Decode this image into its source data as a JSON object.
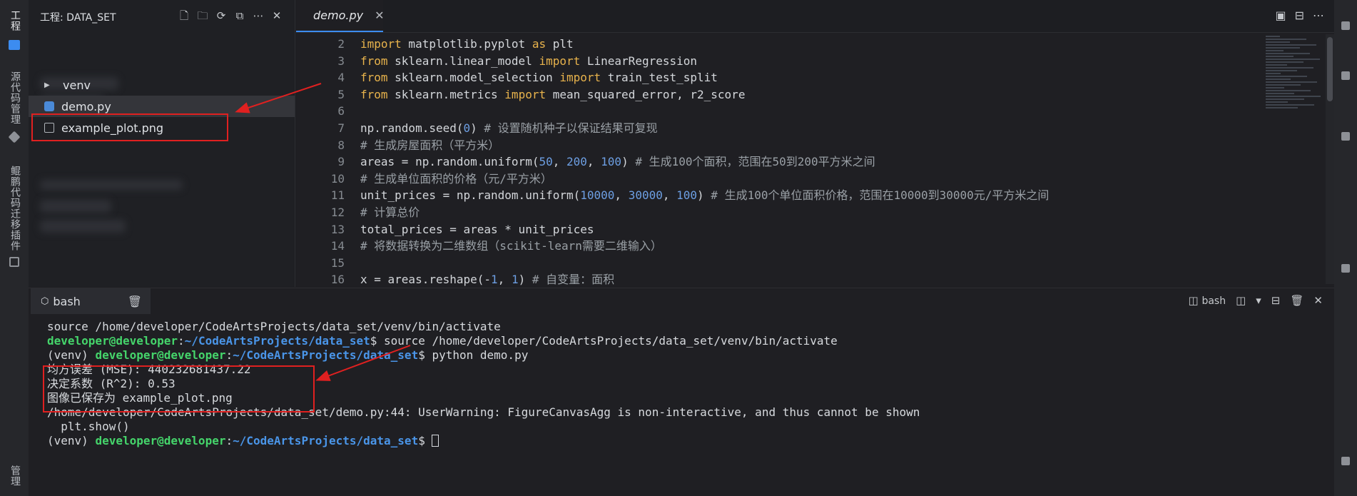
{
  "activity_bar": {
    "items": [
      {
        "label": "工程"
      },
      {
        "label": "源代码管理"
      },
      {
        "label": "鲲鹏代码迁移插件"
      },
      {
        "label": "管理"
      }
    ]
  },
  "explorer": {
    "title": "工程: DATA_SET",
    "actions": [
      "new-file-icon",
      "new-folder-icon",
      "refresh-icon",
      "collapse-icon",
      "more-icon",
      "close-icon"
    ],
    "items": [
      {
        "label": "venv",
        "type": "folder"
      },
      {
        "label": "demo.py",
        "type": "python"
      },
      {
        "label": "example_plot.png",
        "type": "image"
      }
    ]
  },
  "editor": {
    "tab_label": "demo.py",
    "lines": [
      {
        "n": "2",
        "parts": [
          [
            "kw",
            "import"
          ],
          [
            "t",
            " matplotlib.pyplot "
          ],
          [
            "kw",
            "as"
          ],
          [
            "t",
            " plt"
          ]
        ]
      },
      {
        "n": "3",
        "parts": [
          [
            "kw",
            "from"
          ],
          [
            "t",
            " sklearn.linear_model "
          ],
          [
            "kw",
            "import"
          ],
          [
            "t",
            " LinearRegression"
          ]
        ]
      },
      {
        "n": "4",
        "parts": [
          [
            "kw",
            "from"
          ],
          [
            "t",
            " sklearn.model_selection "
          ],
          [
            "kw",
            "import"
          ],
          [
            "t",
            " train_test_split"
          ]
        ]
      },
      {
        "n": "5",
        "parts": [
          [
            "kw",
            "from"
          ],
          [
            "t",
            " sklearn.metrics "
          ],
          [
            "kw",
            "import"
          ],
          [
            "t",
            " mean_squared_error, r2_score"
          ]
        ]
      },
      {
        "n": "6",
        "parts": []
      },
      {
        "n": "7",
        "parts": [
          [
            "t",
            "np.random.seed("
          ],
          [
            "num",
            "0"
          ],
          [
            "t",
            ") "
          ],
          [
            "cm",
            "# 设置随机种子以保证结果可复现"
          ]
        ]
      },
      {
        "n": "8",
        "parts": [
          [
            "cm",
            "# 生成房屋面积（平方米）"
          ]
        ]
      },
      {
        "n": "9",
        "parts": [
          [
            "t",
            "areas = np.random.uniform("
          ],
          [
            "num",
            "50"
          ],
          [
            "t",
            ", "
          ],
          [
            "num",
            "200"
          ],
          [
            "t",
            ", "
          ],
          [
            "num",
            "100"
          ],
          [
            "t",
            ") "
          ],
          [
            "cm",
            "# 生成100个面积，范围在50到200平方米之间"
          ]
        ]
      },
      {
        "n": "10",
        "parts": [
          [
            "cm",
            "# 生成单位面积的价格（元/平方米）"
          ]
        ]
      },
      {
        "n": "11",
        "parts": [
          [
            "t",
            "unit_prices = np.random.uniform("
          ],
          [
            "num",
            "10000"
          ],
          [
            "t",
            ", "
          ],
          [
            "num",
            "30000"
          ],
          [
            "t",
            ", "
          ],
          [
            "num",
            "100"
          ],
          [
            "t",
            ") "
          ],
          [
            "cm",
            "# 生成100个单位面积价格，范围在10000到30000元/平方米之间"
          ]
        ]
      },
      {
        "n": "12",
        "parts": [
          [
            "cm",
            "# 计算总价"
          ]
        ]
      },
      {
        "n": "13",
        "parts": [
          [
            "t",
            "total_prices = areas * unit_prices"
          ]
        ]
      },
      {
        "n": "14",
        "parts": [
          [
            "cm",
            "# 将数据转换为二维数组（scikit-learn需要二维输入）"
          ]
        ]
      },
      {
        "n": "15",
        "parts": []
      },
      {
        "n": "16",
        "parts": [
          [
            "t",
            "x = areas.reshape(-"
          ],
          [
            "num",
            "1"
          ],
          [
            "t",
            ", "
          ],
          [
            "num",
            "1"
          ],
          [
            "t",
            ") "
          ],
          [
            "cm",
            "# 自变量：面积"
          ]
        ]
      }
    ]
  },
  "terminal": {
    "tab_label": "bash",
    "shell_label": "bash",
    "lines": [
      [
        [
          "t",
          "source /home/developer/CodeArtsProjects/data_set/venv/bin/activate"
        ]
      ],
      [
        [
          "green",
          "developer@developer"
        ],
        [
          "t",
          ":"
        ],
        [
          "blue",
          "~/CodeArtsProjects/data_set"
        ],
        [
          "t",
          "$ source /home/developer/CodeArtsProjects/data_set/venv/bin/activate"
        ]
      ],
      [
        [
          "t",
          "(venv) "
        ],
        [
          "green",
          "developer@developer"
        ],
        [
          "t",
          ":"
        ],
        [
          "blue",
          "~/CodeArtsProjects/data_set"
        ],
        [
          "t",
          "$ python demo.py"
        ]
      ],
      [
        [
          "t",
          "均方误差 (MSE): 440232681437.22"
        ]
      ],
      [
        [
          "t",
          "决定系数 (R^2): 0.53"
        ]
      ],
      [
        [
          "t",
          "图像已保存为 example_plot.png"
        ]
      ],
      [
        [
          "t",
          "/home/developer/CodeArtsProjects/data_set/demo.py:44: UserWarning: FigureCanvasAgg is non-interactive, and thus cannot be shown"
        ]
      ],
      [
        [
          "t",
          "  plt.show()"
        ]
      ],
      [
        [
          "t",
          "(venv) "
        ],
        [
          "green",
          "developer@developer"
        ],
        [
          "t",
          ":"
        ],
        [
          "blue",
          "~/CodeArtsProjects/data_set"
        ],
        [
          "t",
          "$ "
        ],
        [
          "cursor",
          ""
        ]
      ]
    ]
  },
  "colors": {
    "accent": "#3c8cf0",
    "annotation": "#e02020",
    "keyword": "#e8b34c",
    "number": "#6d9fe3",
    "prompt_user": "#45d56b",
    "prompt_path": "#4a95e8"
  }
}
